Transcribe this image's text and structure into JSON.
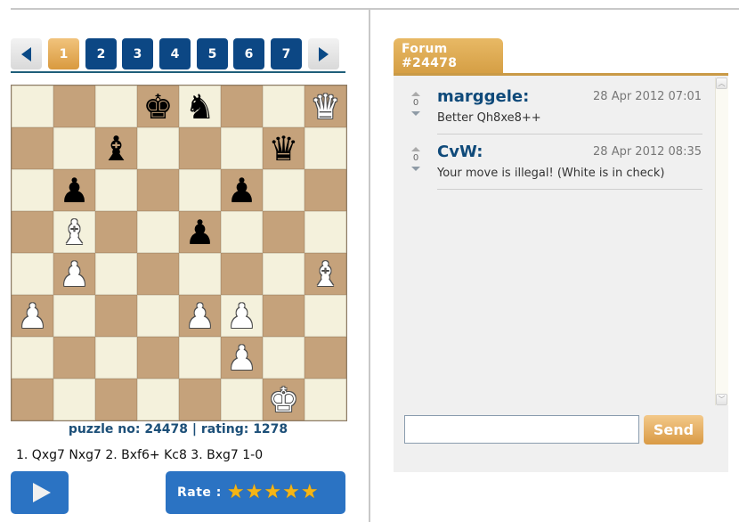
{
  "nav": {
    "prev_icon": "triangle-left-icon",
    "next_icon": "triangle-right-icon",
    "pages": [
      "1",
      "2",
      "3",
      "4",
      "5",
      "6",
      "7"
    ],
    "active_page": "1"
  },
  "board": {
    "light_color": "#f4f1dc",
    "dark_color": "#c5a27b",
    "ranks": [
      [
        "",
        "",
        "",
        "bk",
        "bn",
        "",
        "",
        "wq"
      ],
      [
        "",
        "",
        "bb",
        "",
        "",
        "",
        "bq",
        ""
      ],
      [
        "",
        "bp",
        "",
        "",
        "",
        "bp",
        "",
        ""
      ],
      [
        "",
        "wb",
        "",
        "",
        "bp",
        "",
        "",
        ""
      ],
      [
        "",
        "wp",
        "",
        "",
        "",
        "",
        "",
        "wb"
      ],
      [
        "wp",
        "",
        "",
        "",
        "wp",
        "wp",
        "",
        ""
      ],
      [
        "",
        "",
        "",
        "",
        "",
        "wp",
        "",
        ""
      ],
      [
        "",
        "",
        "",
        "",
        "",
        "",
        "wk",
        ""
      ]
    ],
    "glyphs": {
      "k": "♚",
      "q": "♛",
      "r": "♜",
      "b": "♝",
      "n": "♞",
      "p": "♟"
    }
  },
  "puzzle_info": "puzzle no: 24478 | rating: 1278",
  "solution": "1. Qxg7 Nxg7 2. Bxf6+ Kc8 3. Bxg7 1-0",
  "controls": {
    "play_icon": "play-icon",
    "rate_label": "Rate :",
    "rating_stars": 5,
    "rating_max": 5,
    "star_glyph": "★"
  },
  "forum": {
    "tab_label": "Forum #24478",
    "comments": [
      {
        "user": "marggele:",
        "date": "28 Apr 2012 07:01",
        "text": "Better Qh8xe8++",
        "votes": "0"
      },
      {
        "user": "CvW:",
        "date": "28 Apr 2012 08:35",
        "text": "Your move is illegal! (White is in check)",
        "votes": "0"
      }
    ],
    "input_value": "",
    "input_placeholder": "",
    "send_label": "Send",
    "scroll_up_glyph": "︿",
    "scroll_down_glyph": "﹀"
  }
}
